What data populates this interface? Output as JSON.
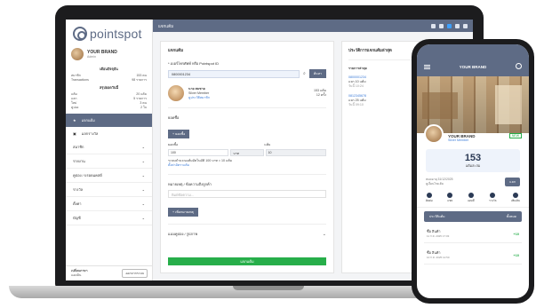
{
  "app": {
    "logo_text": "pointspot"
  },
  "sidebar": {
    "brand_name": "YOUR BRAND",
    "brand_sub": "Admin",
    "stats_head": "เดือนปัจจุบัน",
    "stats": [
      {
        "label": "สมาชิก",
        "value": "153 คน"
      },
      {
        "label": "Transactions",
        "value": "98 รายการ"
      }
    ],
    "summary_head": "สรุปยอดวันนี้",
    "summary_rows": [
      {
        "label": "แต้ม",
        "value": "20 แต้ม"
      },
      {
        "label": "แลก",
        "value": "5 รายการ"
      },
      {
        "label": "ใหม่",
        "value": "3 คน"
      },
      {
        "label": "คูปอง",
        "value": "2 ใบ"
      }
    ],
    "nav_active": "แจกแต้ม",
    "nav_second": "แลกรางวัล",
    "nav_items": [
      "สมาชิก",
      "รายงาน",
      "คูปอง / บรอดแคสต์",
      "รางวัล",
      "ตั้งค่า",
      "บัญชี"
    ],
    "footer_title": "เปลี่ยนภาษา",
    "footer_sub": "แอดมิน",
    "footer_button": "ออกจากระบบ"
  },
  "topbar": {
    "title": "แจกแต้ม"
  },
  "main": {
    "card_title": "แจกแต้ม",
    "phone_label": "* เบอร์โทรศัพท์ หรือ Pointspot ID",
    "phone_value": "0800001234",
    "search_button": "ค้นหา",
    "customer_name": "นาย สมชาย",
    "customer_tier": "Silver Member",
    "customer_link": "ดูประวัติสมาชิก",
    "customer_points_label": "แต้ม",
    "customer_points": "153 แต้ม",
    "customer_visits": "12 ครั้ง",
    "amount_label": "ยอดซื้อ",
    "amount_button": "+ ยอดซื้อ",
    "grid_head": [
      "ยอดซื้อ",
      "",
      "แต้ม"
    ],
    "grid_values": [
      "100",
      "บาท",
      "10"
    ],
    "note_line": "ระบบคำนวณแต้มอัตโนมัติ 100 บาท = 10 แต้ม",
    "note_link": "ตั้งค่าอัตราแต้ม",
    "remark_label": "หมายเหตุ / ข้อความถึงลูกค้า",
    "remark_placeholder": "พิมพ์ข้อความ...",
    "remark_button": "+ เพิ่มหมายเหตุ",
    "coupon_label": "แนบคูปอง / รูปภาพ",
    "submit_label": "แจกแต้ม"
  },
  "side": {
    "title": "ประวัติการแจกแต้มล่าสุด",
    "subtitle": "รายการล่าสุด",
    "entries": [
      {
        "title": "0800001234",
        "text": "แจก 10 แต้ม",
        "date": "วันนี้ 10:24"
      },
      {
        "title": "0812345678",
        "text": "แจก 25 แต้ม",
        "date": "วันนี้ 09:10"
      }
    ]
  },
  "phone": {
    "title": "YOUR BRAND",
    "brand_name": "YOUR BRAND",
    "brand_sub": "Silver Member",
    "badge": "NEW",
    "points": "153",
    "points_label": "แต้มสะสม",
    "info_line1": "หมดอายุ 31/12/2025",
    "info_line2": "ดูเงื่อนไขแต้ม",
    "redeem_button": "แลก",
    "actions": [
      "ติดต่อ",
      "แชท",
      "แผนที่",
      "รางวัล",
      "เพิ่มเติม"
    ],
    "tab_left": "ประวัติแต้ม",
    "tab_right": "ทั้งหมด",
    "transactions": [
      {
        "title": "ซื้อ สินค้า",
        "date": "11 ก.ค. 2025 17:03",
        "points": "+10"
      },
      {
        "title": "ซื้อ สินค้า",
        "date": "10 ก.ค. 2025 12:50",
        "points": "+10"
      }
    ]
  },
  "colors": {
    "primary": "#5e6b85",
    "success": "#27ae4a",
    "link": "#3b7bd8"
  }
}
